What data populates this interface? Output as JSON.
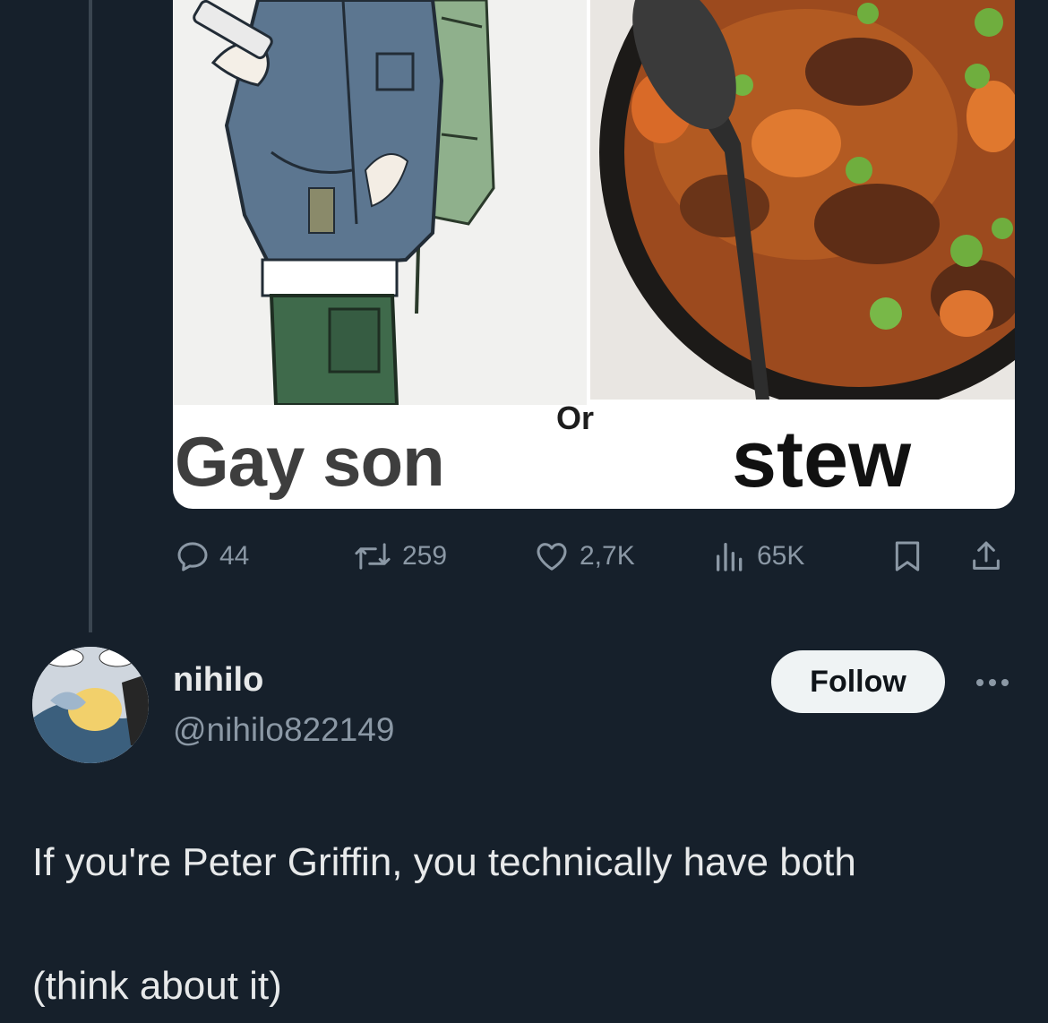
{
  "media": {
    "caption_left": "Gay son",
    "caption_or": "Or",
    "caption_right": "stew"
  },
  "actions": {
    "replies": "44",
    "reposts": "259",
    "likes": "2,7K",
    "views": "65K"
  },
  "reply": {
    "display_name": "nihilo",
    "handle": "@nihilo822149",
    "follow_label": "Follow",
    "text_line1": "If you're Peter Griffin, you technically have both",
    "text_line2": "(think about it)"
  },
  "colors": {
    "background": "#16202b",
    "muted": "#8b98a5",
    "text": "#e7e9ea"
  }
}
